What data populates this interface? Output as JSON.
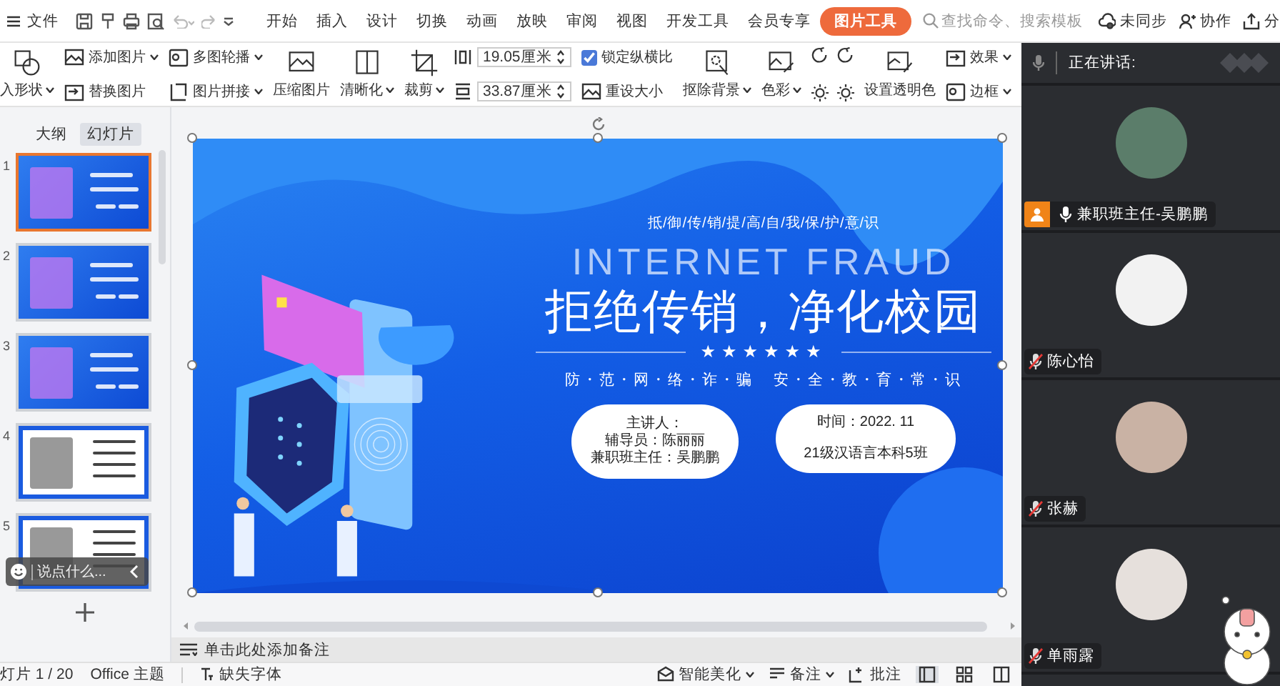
{
  "topbar": {
    "file_menu": "文件",
    "tabs": [
      {
        "label": "开始",
        "selected": false
      },
      {
        "label": "插入",
        "selected": false
      },
      {
        "label": "设计",
        "selected": false
      },
      {
        "label": "切换",
        "selected": false
      },
      {
        "label": "动画",
        "selected": false
      },
      {
        "label": "放映",
        "selected": false
      },
      {
        "label": "审阅",
        "selected": false
      },
      {
        "label": "视图",
        "selected": false
      },
      {
        "label": "开发工具",
        "selected": false
      },
      {
        "label": "会员专享",
        "selected": false
      },
      {
        "label": "图片工具",
        "selected": true
      }
    ],
    "search": {
      "placeholder": "查找命令、搜索模板"
    },
    "actions": [
      "未同步",
      "协作",
      "分"
    ]
  },
  "ribbon": {
    "columns": [
      [
        {
          "kind": "large",
          "label": "入形状",
          "dropdown": true
        }
      ],
      [
        {
          "kind": "small",
          "label": "添加图片",
          "dropdown": true
        },
        {
          "kind": "small",
          "label": "替换图片",
          "dropdown": false
        }
      ],
      [
        {
          "kind": "small",
          "label": "多图轮播",
          "dropdown": true
        },
        {
          "kind": "small",
          "label": "图片拼接",
          "dropdown": true
        }
      ],
      [
        {
          "kind": "large",
          "label": "压缩图片",
          "dropdown": false
        }
      ],
      [
        {
          "kind": "large",
          "label": "清晰化",
          "dropdown": true
        }
      ],
      [
        {
          "kind": "large",
          "label": "裁剪",
          "dropdown": true
        }
      ],
      [
        {
          "kind": "field",
          "value": "19.05厘米"
        },
        {
          "kind": "field",
          "value": "33.87厘米"
        }
      ],
      [
        {
          "kind": "checkbox",
          "label": "锁定纵横比",
          "checked": true
        },
        {
          "kind": "small",
          "label": "重设大小",
          "dropdown": false
        }
      ],
      [
        {
          "kind": "large",
          "label": "抠除背景",
          "dropdown": true
        }
      ],
      [
        {
          "kind": "large",
          "label": "色彩",
          "dropdown": true
        }
      ],
      [
        {
          "kind": "icon"
        },
        {
          "kind": "icon"
        }
      ],
      [
        {
          "kind": "large",
          "label": "设置透明色",
          "dropdown": false
        }
      ],
      [
        {
          "kind": "small",
          "label": "效果",
          "dropdown": true
        },
        {
          "kind": "small",
          "label": "边框",
          "dropdown": true
        }
      ]
    ]
  },
  "slide_panel": {
    "tabs": [
      {
        "label": "大纲",
        "selected": false
      },
      {
        "label": "幻灯片",
        "selected": true
      }
    ],
    "slides": [
      {
        "number": "1",
        "kind": "blue",
        "selected": true
      },
      {
        "number": "2",
        "kind": "blue",
        "selected": false
      },
      {
        "number": "3",
        "kind": "blue",
        "selected": false
      },
      {
        "number": "4",
        "kind": "white",
        "selected": false
      },
      {
        "number": "5",
        "kind": "white",
        "selected": false
      }
    ],
    "chat": {
      "placeholder": "说点什么..."
    }
  },
  "slide": {
    "tagline": "抵/御/传/销/提/高/自/我/保/护/意/识",
    "english_title": "INTERNET FRAUD",
    "title": "拒绝传销，净化校园",
    "decoration": "★★★★★★",
    "slogans": [
      "防・范・网・络・诈・骗",
      "安・全・教・育・常・识"
    ],
    "info_cards": [
      [
        "主讲人：",
        "辅导员：陈丽丽",
        "兼职班主任：吴鹏鹏"
      ],
      [
        "时间：2022. 11",
        "21级汉语言本科5班"
      ]
    ]
  },
  "notes": {
    "placeholder": "单击此处添加备注"
  },
  "status_bar": {
    "left": [
      "灯片 1 / 20",
      "Office 主题",
      "缺失字体"
    ],
    "right": [
      "智能美化",
      "备注",
      "批注"
    ],
    "view_buttons": [
      {
        "selected": true
      },
      {
        "selected": false
      },
      {
        "selected": false
      }
    ]
  },
  "meeting_panel": {
    "header": "正在讲话:",
    "participants": [
      {
        "name": "兼职班主任-吴鹏鹏",
        "muted": false,
        "host": true
      },
      {
        "name": "陈心怡",
        "muted": true,
        "host": false
      },
      {
        "name": "张赫",
        "muted": true,
        "host": false
      },
      {
        "name": "单雨露",
        "muted": true,
        "host": false
      }
    ]
  }
}
